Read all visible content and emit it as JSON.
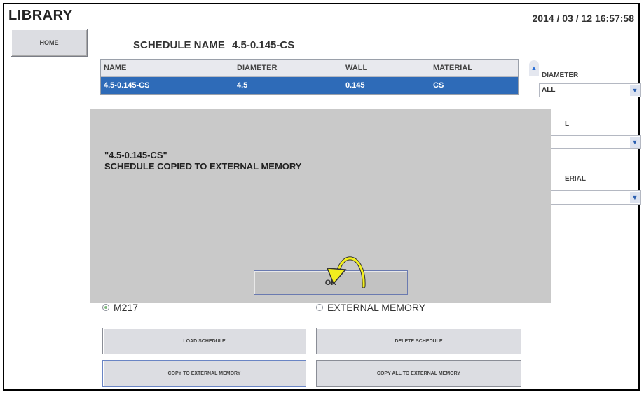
{
  "header": {
    "title": "LIBRARY",
    "datetime": "2014 / 03 / 12   16:57:58"
  },
  "home_label": "HOME",
  "schedule": {
    "label": "SCHEDULE NAME",
    "value": "4.5-0.145-CS"
  },
  "table": {
    "columns": [
      "NAME",
      "DIAMETER",
      "WALL",
      "MATERIAL"
    ],
    "selected_row": [
      "4.5-0.145-CS",
      "4.5",
      "0.145",
      "CS"
    ]
  },
  "filters": {
    "diameter": {
      "label": "DIAMETER",
      "value": "ALL"
    },
    "wall": {
      "label": "L"
    },
    "material": {
      "label": "ERIAL"
    }
  },
  "dialog": {
    "line1": "\"4.5-0.145-CS\"",
    "line2": "SCHEDULE COPIED TO EXTERNAL MEMORY",
    "ok": "OK"
  },
  "storage": {
    "option1": "M217",
    "option2": "EXTERNAL MEMORY",
    "selected": "M217"
  },
  "buttons": {
    "load": "LOAD SCHEDULE",
    "delete": "DELETE SCHEDULE",
    "copy": "COPY TO EXTERNAL MEMORY",
    "copy_all": "COPY ALL TO EXTERNAL MEMORY"
  },
  "colors": {
    "selection": "#2e6bb8",
    "arrow": "#f2ee1e"
  }
}
